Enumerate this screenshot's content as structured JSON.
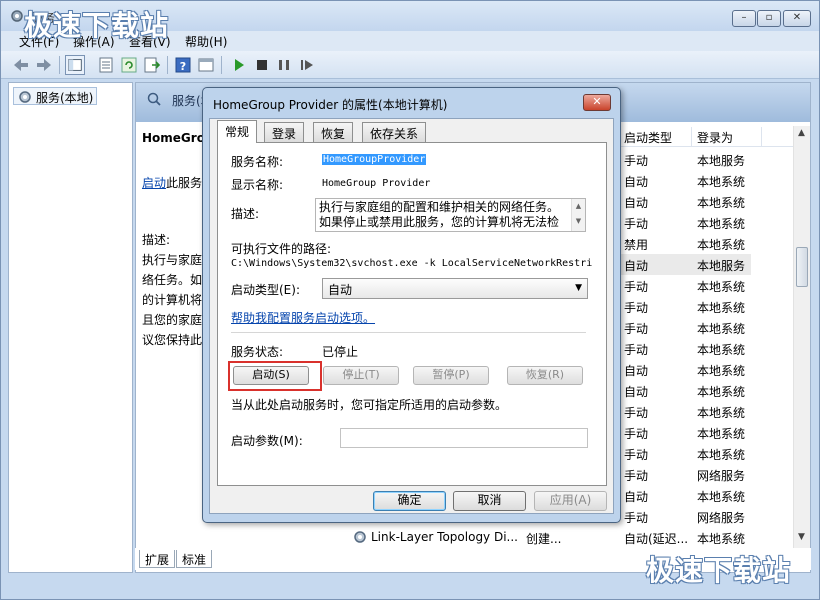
{
  "window": {
    "title": "服务",
    "buttons": {
      "minimize": "–",
      "maximize": "▫",
      "close": "✕"
    }
  },
  "menu": [
    "文件(F)",
    "操作(A)",
    "查看(V)",
    "帮助(H)"
  ],
  "left_pane": {
    "tree_item": "服务(本地)"
  },
  "right_pane": {
    "header_title": "服务(本地)",
    "desc_title": "HomeGroup Provider",
    "start_link": "启动",
    "start_suffix": "此服务",
    "desc_label": "描述:",
    "desc_lines": [
      "执行与家庭组的配置和维护相关的网络任务。如",
      "络任务。如",
      "的计算机将",
      "且您的家庭",
      "议您保持此"
    ],
    "columns": [
      "启动类型",
      "登录为"
    ],
    "rows": [
      {
        "startup": "手动",
        "logon": "本地服务"
      },
      {
        "startup": "自动",
        "logon": "本地系统"
      },
      {
        "startup": "自动",
        "logon": "本地系统"
      },
      {
        "startup": "手动",
        "logon": "本地系统"
      },
      {
        "startup": "禁用",
        "logon": "本地系统"
      },
      {
        "startup": "自动",
        "logon": "本地服务"
      },
      {
        "startup": "手动",
        "logon": "本地系统"
      },
      {
        "startup": "手动",
        "logon": "本地系统"
      },
      {
        "startup": "手动",
        "logon": "本地系统"
      },
      {
        "startup": "手动",
        "logon": "本地系统"
      },
      {
        "startup": "自动",
        "logon": "本地系统"
      },
      {
        "startup": "自动",
        "logon": "本地系统"
      },
      {
        "startup": "手动",
        "logon": "本地系统"
      },
      {
        "startup": "手动",
        "logon": "本地系统"
      },
      {
        "startup": "手动",
        "logon": "本地系统"
      },
      {
        "startup": "手动",
        "logon": "网络服务"
      },
      {
        "startup": "自动",
        "logon": "本地系统"
      },
      {
        "startup": "手动",
        "logon": "网络服务"
      },
      {
        "startup": "自动(延迟...",
        "logon": "本地系统"
      },
      {
        "startup": "手动",
        "logon": "本地服务"
      }
    ],
    "bottom_row": {
      "name": "Link-Layer Topology Di...",
      "status": "创建..."
    },
    "tabs": [
      "扩展",
      "标准"
    ]
  },
  "dialog": {
    "title": "HomeGroup Provider 的属性(本地计算机)",
    "close_label": "✕",
    "tabs": [
      "常规",
      "登录",
      "恢复",
      "依存关系"
    ],
    "service_name_label": "服务名称:",
    "service_name_value": "HomeGroupProvider",
    "display_name_label": "显示名称:",
    "display_name_value": "HomeGroup Provider",
    "description_label": "描述:",
    "description_value": "执行与家庭组的配置和维护相关的网络任务。如果停止或禁用此服务，您的计算机将无法检",
    "path_label": "可执行文件的路径:",
    "path_value": "C:\\Windows\\System32\\svchost.exe -k LocalServiceNetworkRestri",
    "startup_type_label": "启动类型(E):",
    "startup_type_value": "自动",
    "help_link": "帮助我配置服务启动选项。",
    "status_label": "服务状态:",
    "status_value": "已停止",
    "start_button": "启动(S)",
    "stop_button": "停止(T)",
    "pause_button": "暂停(P)",
    "resume_button": "恢复(R)",
    "hint": "当从此处启动服务时，您可指定所适用的启动参数。",
    "params_label": "启动参数(M):",
    "params_value": "",
    "ok_button": "确定",
    "cancel_button": "取消",
    "apply_button": "应用(A)"
  },
  "watermark": "极速下载站",
  "colors": {
    "highlight_box": "#d9312c",
    "link": "#0645ad",
    "selection": "#3399ff"
  }
}
